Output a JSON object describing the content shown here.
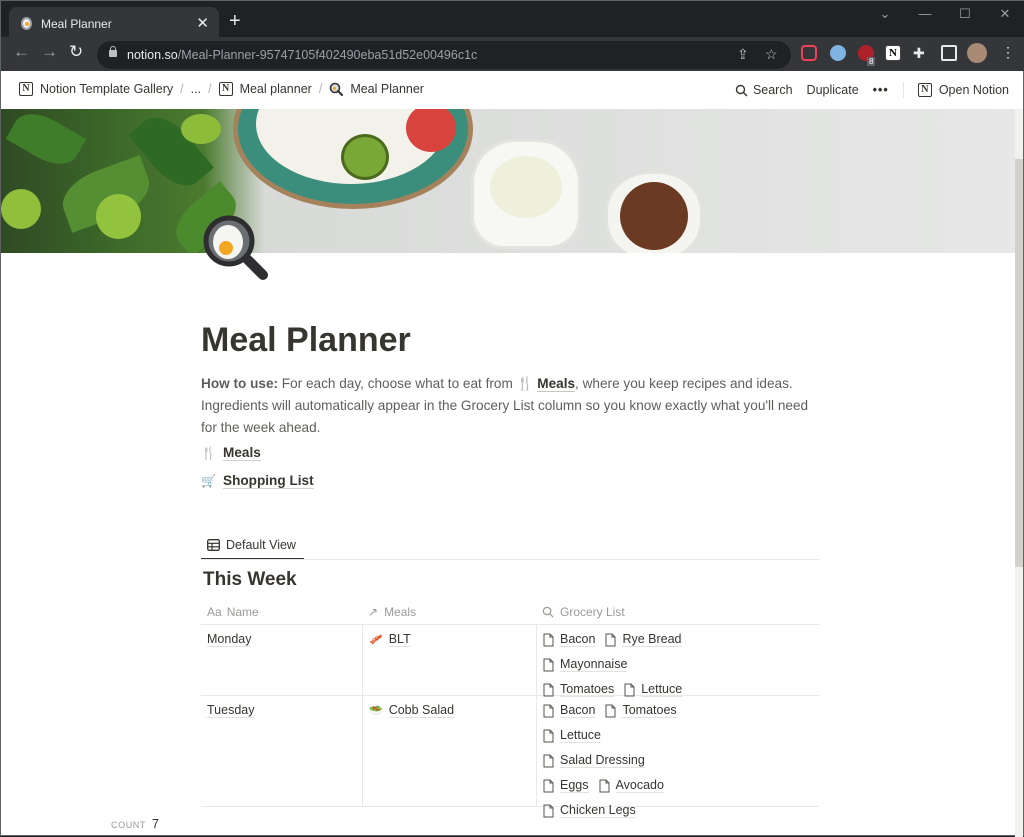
{
  "browser": {
    "tab_title": "Meal Planner",
    "url_host": "notion.so",
    "url_path": "/Meal-Planner-95747105f402490eba51d52e00496c1c",
    "extension_badge": "8"
  },
  "topbar": {
    "breadcrumbs": [
      {
        "label": "Notion Template Gallery",
        "icon": "notion-logo-icon"
      },
      {
        "label": "...",
        "icon": ""
      },
      {
        "label": "Meal planner",
        "icon": "notion-logo-icon"
      },
      {
        "label": "Meal Planner",
        "icon": "frying-pan-icon"
      }
    ],
    "search_label": "Search",
    "duplicate_label": "Duplicate",
    "more_label": "•••",
    "open_notion_label": "Open Notion"
  },
  "page": {
    "title": "Meal Planner",
    "howto_prefix": "How to use:",
    "howto_text_1": " For each day, choose what to eat from ",
    "howto_link": "Meals",
    "howto_text_2": ", where you keep recipes and ideas. Ingredients will automatically appear in the Grocery List column so you know exactly what you'll need for the week ahead.",
    "links": [
      {
        "label": "Meals",
        "icon": "fork-knife-icon"
      },
      {
        "label": "Shopping List",
        "icon": "shopping-cart-icon"
      }
    ]
  },
  "database": {
    "view_tab": "Default View",
    "title": "This Week",
    "columns": [
      {
        "label": "Name",
        "icon": "Aa"
      },
      {
        "label": "Meals",
        "icon": "↗"
      },
      {
        "label": "Grocery List",
        "icon": "search"
      }
    ],
    "rows": [
      {
        "name": "Monday",
        "meal": "BLT",
        "meal_icon": "bacon-icon",
        "groceries": [
          "Bacon",
          "Rye Bread",
          "Mayonnaise",
          "Tomatoes",
          "Lettuce"
        ]
      },
      {
        "name": "Tuesday",
        "meal": "Cobb Salad",
        "meal_icon": "salad-icon",
        "groceries": [
          "Bacon",
          "Tomatoes",
          "Lettuce",
          "Salad Dressing",
          "Eggs",
          "Avocado",
          "Chicken Legs"
        ]
      }
    ],
    "count_label": "COUNT",
    "count_value": "7"
  }
}
